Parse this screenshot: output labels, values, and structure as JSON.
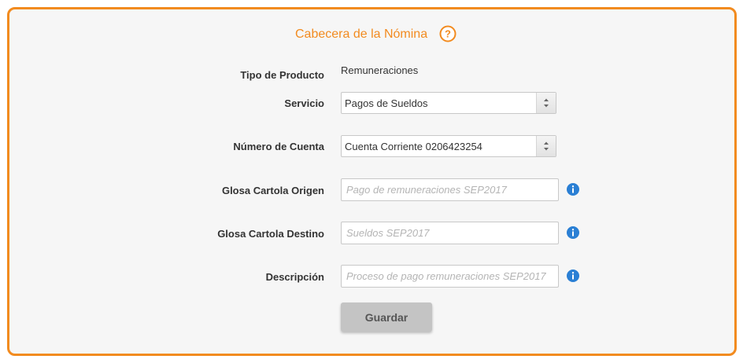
{
  "header": {
    "title": "Cabecera de la Nómina",
    "help_icon": "question-circle-icon"
  },
  "form": {
    "tipo_producto": {
      "label": "Tipo de Producto",
      "value": "Remuneraciones"
    },
    "servicio": {
      "label": "Servicio",
      "selected": "Pagos de Sueldos"
    },
    "numero_cuenta": {
      "label": "Número de Cuenta",
      "selected": "Cuenta Corriente 0206423254"
    },
    "glosa_origen": {
      "label": "Glosa Cartola Origen",
      "placeholder": "Pago de remuneraciones SEP2017",
      "value": ""
    },
    "glosa_destino": {
      "label": "Glosa Cartola Destino",
      "placeholder": "Sueldos SEP2017",
      "value": ""
    },
    "descripcion": {
      "label": "Descripción",
      "placeholder": "Proceso de pago remuneraciones SEP2017",
      "value": ""
    },
    "info_icon": "info-circle-icon",
    "save_label": "Guardar"
  },
  "colors": {
    "accent": "#f28b1f",
    "info": "#2a7fd4",
    "panel_background": "#f6f6f6",
    "button_background": "#c4c4c4"
  }
}
